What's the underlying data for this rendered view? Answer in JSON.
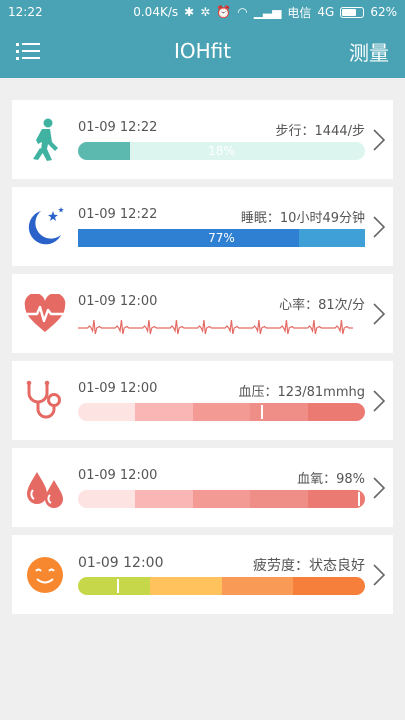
{
  "statusbar": {
    "time": "12:22",
    "speed": "0.04K/s",
    "carrier": "电信",
    "network": "4G",
    "battery": "62%"
  },
  "appbar": {
    "title": "IOHfit",
    "measure_label": "测量"
  },
  "cards": {
    "steps": {
      "date": "01-09 12:22",
      "value": "步行：1444/步",
      "percent_label": "18%",
      "percent": 18,
      "fill_color": "#5bb9b0",
      "track_color": "#dcf5ef",
      "icon": "walking-person-icon"
    },
    "sleep": {
      "date": "01-09 12:22",
      "value": "睡眠：10小时49分钟",
      "percent_label": "77%",
      "percent": 77,
      "fill_color": "#2f7fd2",
      "track_color": "#3ea0d6",
      "icon": "moon-stars-icon"
    },
    "heart": {
      "date": "01-09 12:00",
      "value": "心率：81次/分",
      "line_color": "#e56a64",
      "icon": "heart-pulse-icon"
    },
    "bp": {
      "date": "01-09 12:00",
      "value": "血压：123/81mmhg",
      "segment_colors": [
        "#fde3e1",
        "#fab6b4",
        "#f49a95",
        "#ef8d87",
        "#ea7a72"
      ],
      "marker_fraction": 0.64,
      "icon": "stethoscope-icon"
    },
    "oxygen": {
      "date": "01-09 12:00",
      "value": "血氧：98%",
      "segment_colors": [
        "#fde3e1",
        "#fab6b4",
        "#f49a95",
        "#ef8d87",
        "#ea7a72"
      ],
      "marker_fraction": 0.98,
      "icon": "blood-drops-icon"
    },
    "fatigue": {
      "date": "01-09 12:00",
      "value": "疲劳度：状态良好",
      "segment_colors": [
        "#c6d84a",
        "#ffc25c",
        "#f99b57",
        "#f77f3c"
      ],
      "marker_fraction": 0.14,
      "icon": "smiley-face-icon"
    }
  }
}
